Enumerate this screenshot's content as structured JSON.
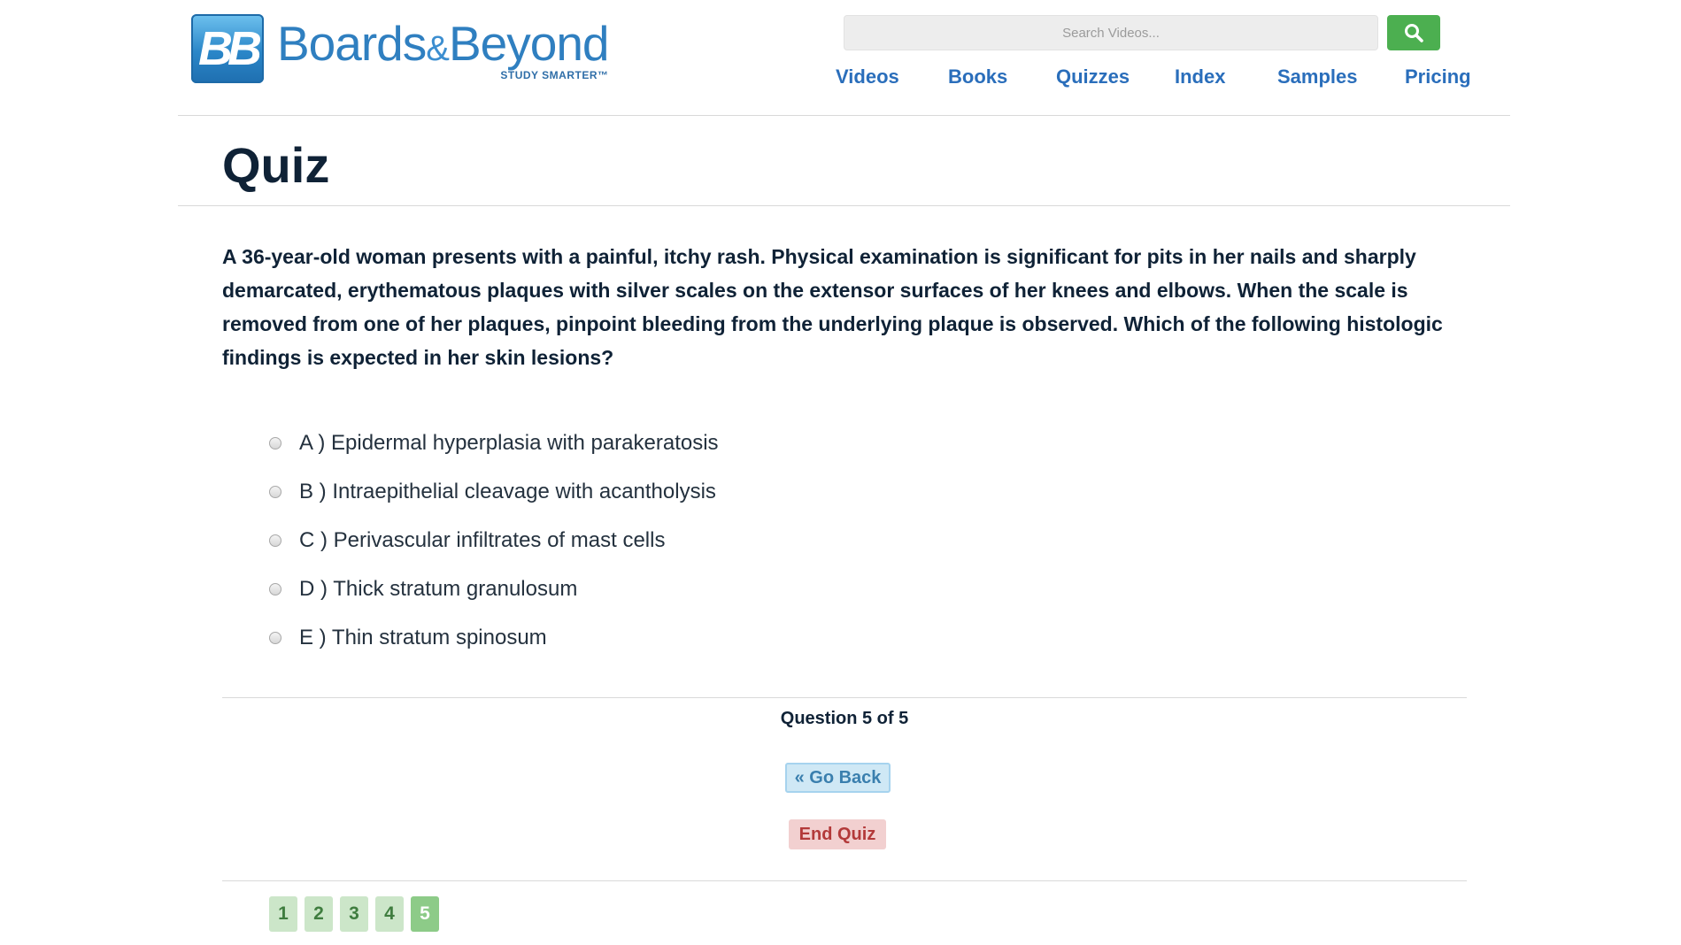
{
  "brand": {
    "mark": "BB",
    "name_part1": "Boards",
    "name_amp": "&",
    "name_part2": "Beyond",
    "tagline": "STUDY SMARTER™"
  },
  "search": {
    "placeholder": "Search Videos...",
    "button_icon": "search-icon"
  },
  "nav": {
    "items": [
      "Videos",
      "Books",
      "Quizzes",
      "Index",
      "Samples",
      "Pricing"
    ]
  },
  "page": {
    "title": "Quiz"
  },
  "question": {
    "text": "A 36-year-old woman presents with a painful, itchy rash. Physical examination is significant for pits in her nails and sharply demarcated, erythematous plaques with silver scales on the extensor surfaces of her knees and elbows. When the scale is removed from one of her plaques, pinpoint bleeding from the underlying plaque is observed. Which of the following histologic findings is expected in her skin lesions?",
    "answers": [
      "A ) Epidermal hyperplasia with parakeratosis",
      "B ) Intraepithelial cleavage with acantholysis",
      "C ) Perivascular infiltrates of mast cells",
      "D ) Thick stratum granulosum",
      "E ) Thin stratum spinosum"
    ]
  },
  "progress": {
    "label": "Question 5 of 5",
    "current": 5,
    "total": 5
  },
  "buttons": {
    "go_back": "« Go Back",
    "end_quiz": "End Quiz"
  },
  "pagination": {
    "pages": [
      "1",
      "2",
      "3",
      "4",
      "5"
    ],
    "active": "5"
  },
  "colors": {
    "nav_link": "#2a6ebb",
    "search_button": "#4caf50",
    "go_back_bg": "#cfe8f5",
    "end_quiz_bg": "#f2d0d0",
    "page_btn": "#cce6c9",
    "page_btn_active": "#8dcb88"
  }
}
